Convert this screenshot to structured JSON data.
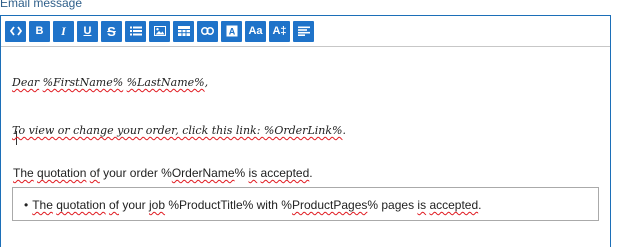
{
  "field_label": "Email message",
  "toolbar": [
    {
      "name": "source-code-button",
      "icon": "code-icon"
    },
    {
      "name": "bold-button",
      "text": "B"
    },
    {
      "name": "italic-button",
      "text": "I"
    },
    {
      "name": "underline-button",
      "text": "U"
    },
    {
      "name": "strikethrough-button",
      "text": "S"
    },
    {
      "name": "bulleted-list-button",
      "icon": "list-icon"
    },
    {
      "name": "insert-image-button",
      "icon": "image-icon"
    },
    {
      "name": "insert-table-button",
      "icon": "table-icon"
    },
    {
      "name": "insert-link-button",
      "icon": "link-icon"
    },
    {
      "name": "text-color-button",
      "text": "A"
    },
    {
      "name": "font-size-button",
      "text": "Aa"
    },
    {
      "name": "line-height-button",
      "text": "A‡"
    },
    {
      "name": "align-button",
      "icon": "align-left-icon"
    }
  ],
  "content": {
    "greeting": {
      "dear": "Dear",
      "first_name": "%FirstName%",
      "last_name": "%LastName%",
      "trailing": ","
    },
    "order_link_sentence": {
      "text": "To view or change your order, click this link: ",
      "link_var": "%OrderLink%",
      "trailing": "."
    },
    "quotation_sentence": {
      "the": "The",
      "quotation": "quotation",
      "of": "of",
      "middle": "your order %",
      "order_name": "OrderName",
      "after": "% ",
      "is": "is",
      "accepted": "accepted",
      "trailing": "."
    },
    "job_box_item": {
      "bullet": "•",
      "the": "The",
      "quotation": "quotation",
      "of": "of",
      "your": "your",
      "job": "job",
      "mid1": "%ProductTitle% with %",
      "product_pages": "ProductPages",
      "mid2": "% pages ",
      "is": "is",
      "accepted": "accepted",
      "trailing": "."
    }
  }
}
